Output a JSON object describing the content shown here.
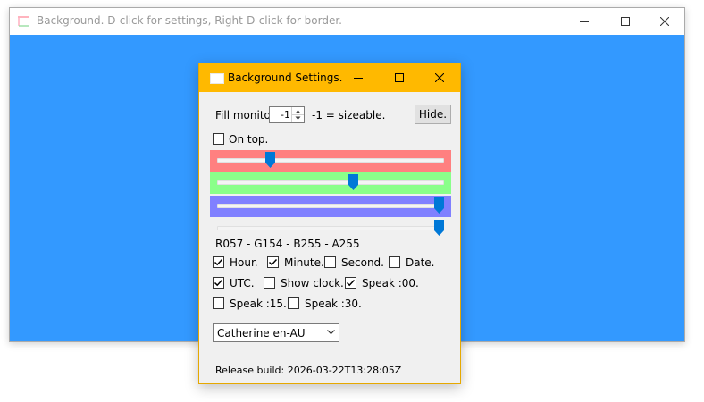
{
  "main_window": {
    "title": "Background. D-click for settings, Right-D-click for border.",
    "background_color": "#3399ff",
    "icons": [
      "app-icon",
      "minimize-icon",
      "maximize-icon",
      "close-icon"
    ]
  },
  "settings": {
    "title": "Background Settings.",
    "titlebar_color": "#ffb900",
    "fill_monitor_label": "Fill monitor:",
    "fill_monitor_value": "-1",
    "fill_monitor_hint": "-1 = sizeable.",
    "hide_button": "Hide.",
    "on_top_label": "On top.",
    "on_top_checked": false,
    "sliders": [
      {
        "name": "red",
        "value": 57,
        "max": 255,
        "band_color": "#ff8080"
      },
      {
        "name": "green",
        "value": 154,
        "max": 255,
        "band_color": "#8aff8a"
      },
      {
        "name": "blue",
        "value": 255,
        "max": 255,
        "band_color": "#8080ff"
      },
      {
        "name": "alpha",
        "value": 255,
        "max": 255,
        "band_color": "#f0f0f0"
      }
    ],
    "rgba_readout": "R057 - G154 - B255 - A255",
    "checkboxes": [
      {
        "label": "Hour.",
        "checked": true
      },
      {
        "label": "Minute.",
        "checked": true
      },
      {
        "label": "Second.",
        "checked": false
      },
      {
        "label": "Date.",
        "checked": false
      },
      {
        "label": "UTC.",
        "checked": true
      },
      {
        "label": "Show clock.",
        "checked": false
      },
      {
        "label": "Speak :00.",
        "checked": true
      },
      {
        "label": "Speak :15.",
        "checked": false
      },
      {
        "label": "Speak :30.",
        "checked": false
      }
    ],
    "voice_selected": "Catherine en-AU",
    "release_build": "Release build: 2026-03-22T13:28:05Z"
  }
}
